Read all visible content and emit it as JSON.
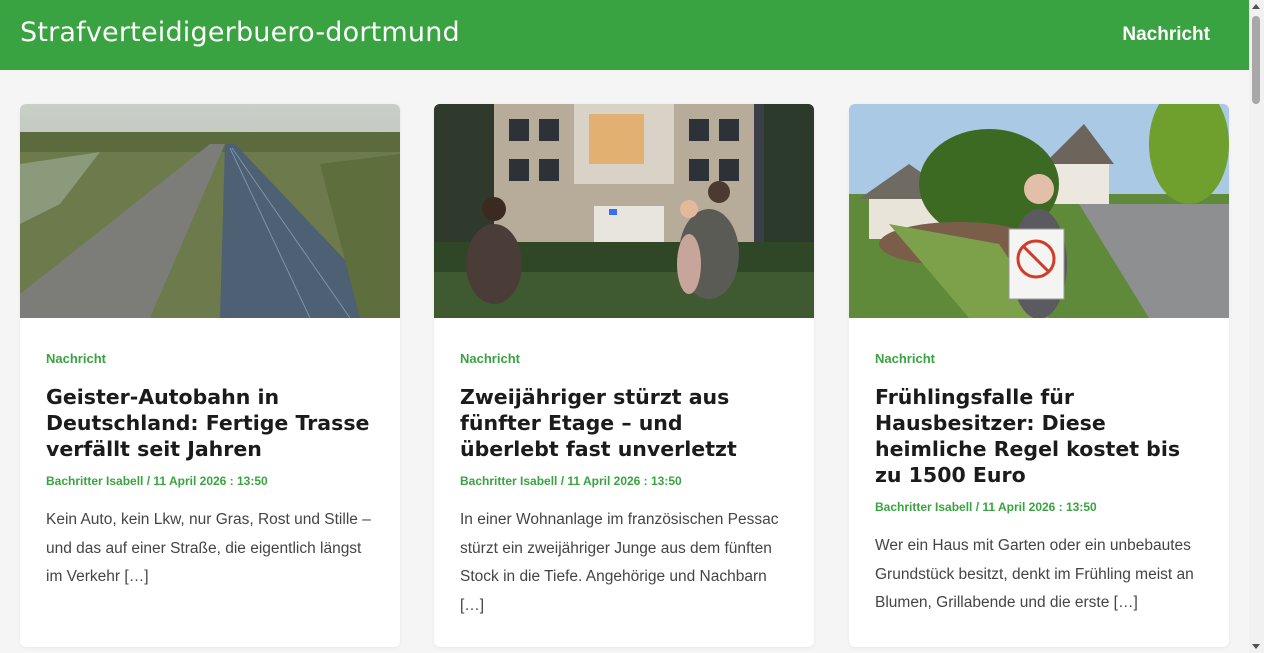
{
  "header": {
    "site_title": "Strafverteidigerbuero-dortmund",
    "nav_label": "Nachricht"
  },
  "colors": {
    "brand_green": "#3aa341",
    "page_bg": "#f5f5f5"
  },
  "articles": [
    {
      "category": "Nachricht",
      "title": "Geister-Autobahn in Deutschland: Fertige Trasse verfällt seit Jahren",
      "author": "Bachritter Isabell",
      "separator": "/",
      "date": "11 April 2026 : 13:50",
      "excerpt": "Kein Auto, kein Lkw, nur Gras, Rost und Stille – und das auf einer Straße, die eigentlich längst im Verkehr […]",
      "image": "abandoned-highway-photo"
    },
    {
      "category": "Nachricht",
      "title": "Zweijähriger stürzt aus fünfter Etage – und überlebt fast unverletzt",
      "author": "Bachritter Isabell",
      "separator": "/",
      "date": "11 April 2026 : 13:50",
      "excerpt": "In einer Wohnanlage im französischen Pessac stürzt ein zweijähriger Junge aus dem fünften Stock in die Tiefe. Angehörige und Nachbarn […]",
      "image": "apartment-building-family-photo"
    },
    {
      "category": "Nachricht",
      "title": "Frühlingsfalle für Hausbesitzer: Diese heimliche Regel kostet bis zu 1500 Euro",
      "author": "Bachritter Isabell",
      "separator": "/",
      "date": "11 April 2026 : 13:50",
      "excerpt": "Wer ein Haus mit Garten oder ein unbebautes Grundstück besitzt, denkt im Frühling meist an Blumen, Grillabende und die erste […]",
      "image": "man-with-sign-street-photo"
    }
  ]
}
